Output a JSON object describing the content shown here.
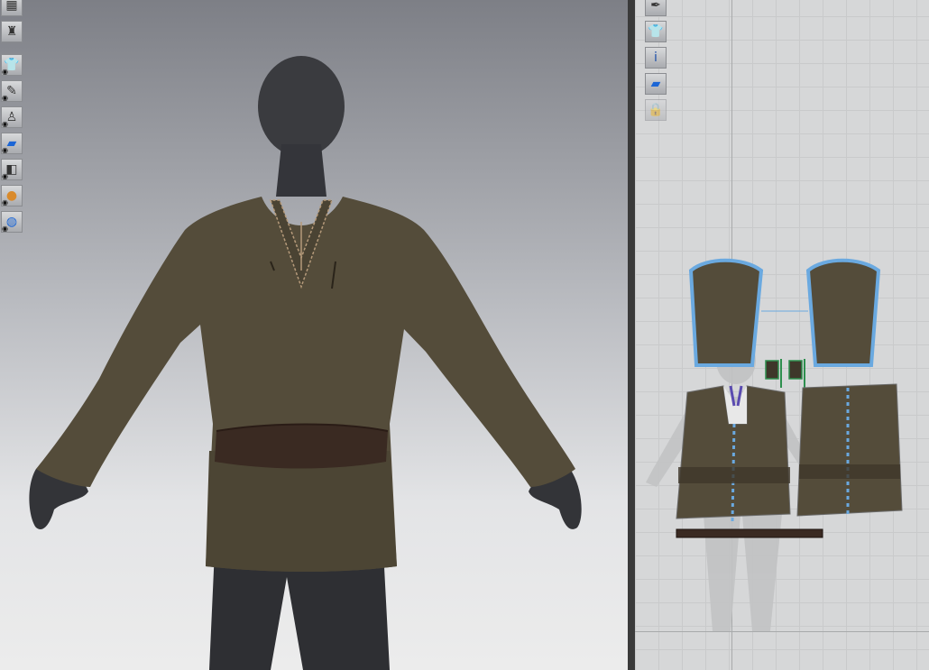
{
  "viewport3d": {
    "toolbar": [
      {
        "icon": "layer-icon",
        "glyph": "▦"
      },
      {
        "icon": "garment-outline-icon",
        "glyph": "♜"
      },
      {
        "icon": "show-garment-icon",
        "glyph": "👕"
      },
      {
        "icon": "show-brush-icon",
        "glyph": "✎"
      },
      {
        "icon": "show-avatar-icon",
        "glyph": "♙"
      },
      {
        "icon": "texture-icon",
        "glyph": "▰"
      },
      {
        "icon": "material-icon",
        "glyph": "◧"
      },
      {
        "icon": "avatar-head-icon",
        "glyph": "●"
      },
      {
        "icon": "globe-icon",
        "glyph": "◍"
      }
    ]
  },
  "viewport2d": {
    "toolbar": [
      {
        "icon": "pen-icon",
        "glyph": "✒"
      },
      {
        "icon": "garment-icon",
        "glyph": "👕"
      },
      {
        "icon": "info-icon",
        "glyph": "i"
      },
      {
        "icon": "texture-icon",
        "glyph": "▰"
      },
      {
        "icon": "lock-garment-icon",
        "glyph": "🔒"
      }
    ]
  },
  "colors": {
    "fabric": "#544c3a",
    "fabric_dark": "#3e372a",
    "belt": "#3a2a22",
    "avatar": "#35363a",
    "selection": "#6aa9e0"
  }
}
